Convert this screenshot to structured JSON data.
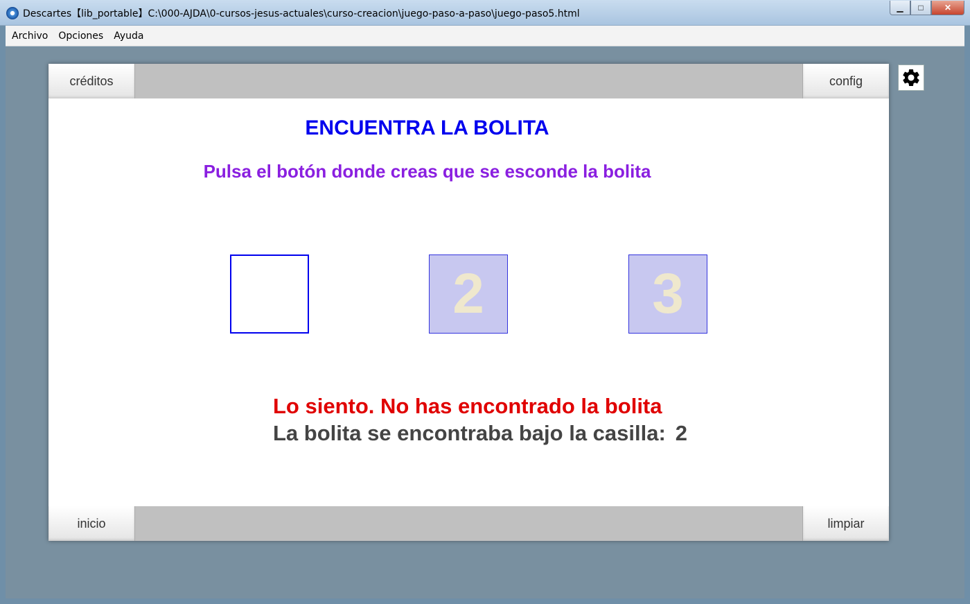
{
  "window": {
    "title": "Descartes【lib_portable】C:\\000-AJDA\\0-cursos-jesus-actuales\\curso-creacion\\juego-paso-a-paso\\juego-paso5.html",
    "minimize": "▁",
    "maximize": "□",
    "close": "✕"
  },
  "menu": {
    "items": [
      "Archivo",
      "Opciones",
      "Ayuda"
    ]
  },
  "scene": {
    "top_left_button": "créditos",
    "top_right_button": "config",
    "bottom_left_button": "inicio",
    "bottom_right_button": "limpiar",
    "settings_icon": "gear-icon",
    "title": "ENCUENTRA LA BOLITA",
    "instruction": "Pulsa el botón donde creas que se esconde la bolita",
    "boxes": [
      {
        "label": "",
        "state": "selected-empty"
      },
      {
        "label": "2",
        "state": "covered"
      },
      {
        "label": "3",
        "state": "covered"
      }
    ],
    "result_message": "Lo siento. No has encontrado la bolita",
    "answer_text": "La bolita se encontraba bajo la casilla:",
    "answer_value": "2"
  },
  "colors": {
    "title": "#0000ee",
    "instruction": "#8a1fe0",
    "result": "#e00000",
    "answer": "#444444",
    "box_border": "#0000ee",
    "box_fill": "#c8c8f0",
    "box_number": "#efe8cd"
  }
}
